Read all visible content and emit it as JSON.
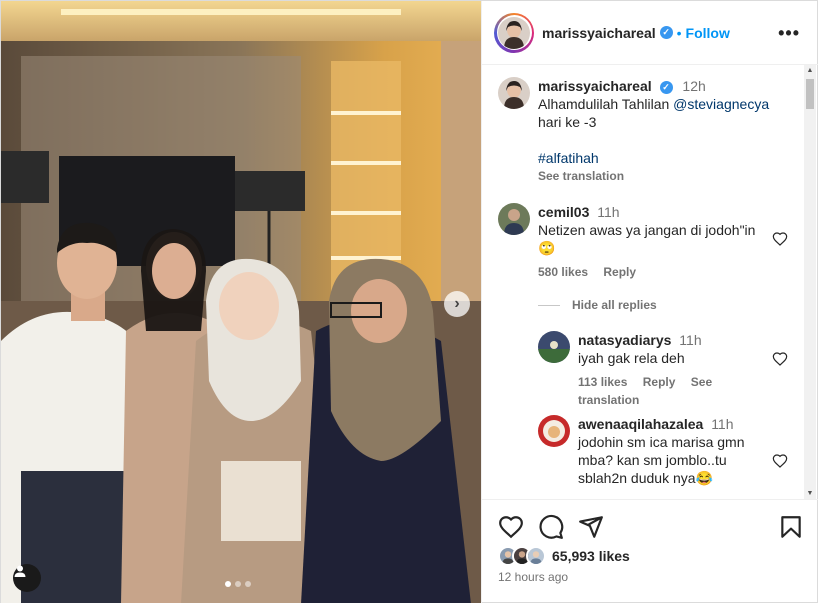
{
  "post": {
    "username": "marissyaichareal",
    "verified_mark": "✓",
    "separator": "•",
    "follow_label": "Follow",
    "more_label": "•••",
    "photo_next_label": "›",
    "carousel_dots": 3,
    "active_dot": 0
  },
  "caption": {
    "username": "marissyaichareal",
    "time": "12h",
    "text_1": "Alhamdulilah Tahlilan ",
    "mention": "@steviagnecya",
    "text_2": "hari ke -3",
    "hashtag": "#alfatihah",
    "see_translation": "See translation"
  },
  "comments": [
    {
      "username": "cemil03",
      "time": "11h",
      "text": "Netizen awas ya jangan di jodoh\"in",
      "emoji": "🙄",
      "likes": "580 likes",
      "reply": "Reply",
      "hide_replies": "Hide all replies"
    }
  ],
  "replies": [
    {
      "username": "natasyadiarys",
      "time": "11h",
      "text": "iyah gak rela deh",
      "likes": "113 likes",
      "reply": "Reply",
      "see_translation": "See translation"
    },
    {
      "username": "awenaaqilahazalea",
      "time": "11h",
      "text_line1": "jodohin sm ica marisa gmn",
      "text_line2": "mba? kan sm jomblo..tu",
      "text_line3": "sblah2n duduk nya😂"
    }
  ],
  "footer": {
    "likes": "65,993 likes",
    "time_ago": "12 hours ago"
  },
  "colors": {
    "accent": "#0095f6",
    "verified": "#3897f0",
    "text": "#262626",
    "muted": "#737373",
    "link": "#00376b"
  }
}
